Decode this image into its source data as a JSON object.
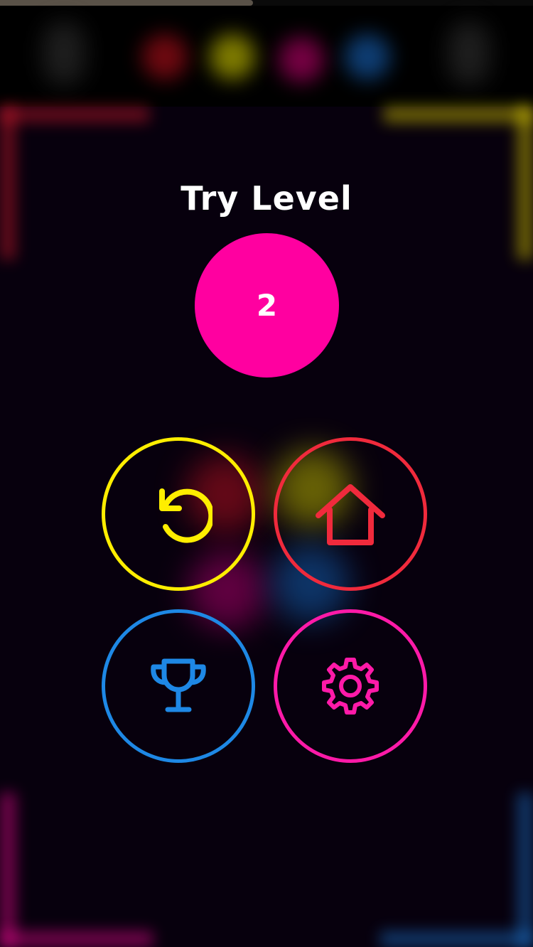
{
  "hud": {
    "progress": 0.475
  },
  "dialog": {
    "title": "Try Level",
    "level_number": "2",
    "level_color": "#ff00a0"
  },
  "buttons": {
    "retry": {
      "icon": "retry-icon",
      "color": "#ffee00"
    },
    "home": {
      "icon": "home-icon",
      "color": "#f02a3c"
    },
    "leaderboard": {
      "icon": "trophy-icon",
      "color": "#1e88e5"
    },
    "settings": {
      "icon": "gear-icon",
      "color": "#ff1aa8"
    }
  },
  "palette": {
    "red": "#e01b2e",
    "yellow": "#f5e400",
    "magenta": "#ff0a9c",
    "blue": "#1e7fe0",
    "background": "#07000d"
  }
}
